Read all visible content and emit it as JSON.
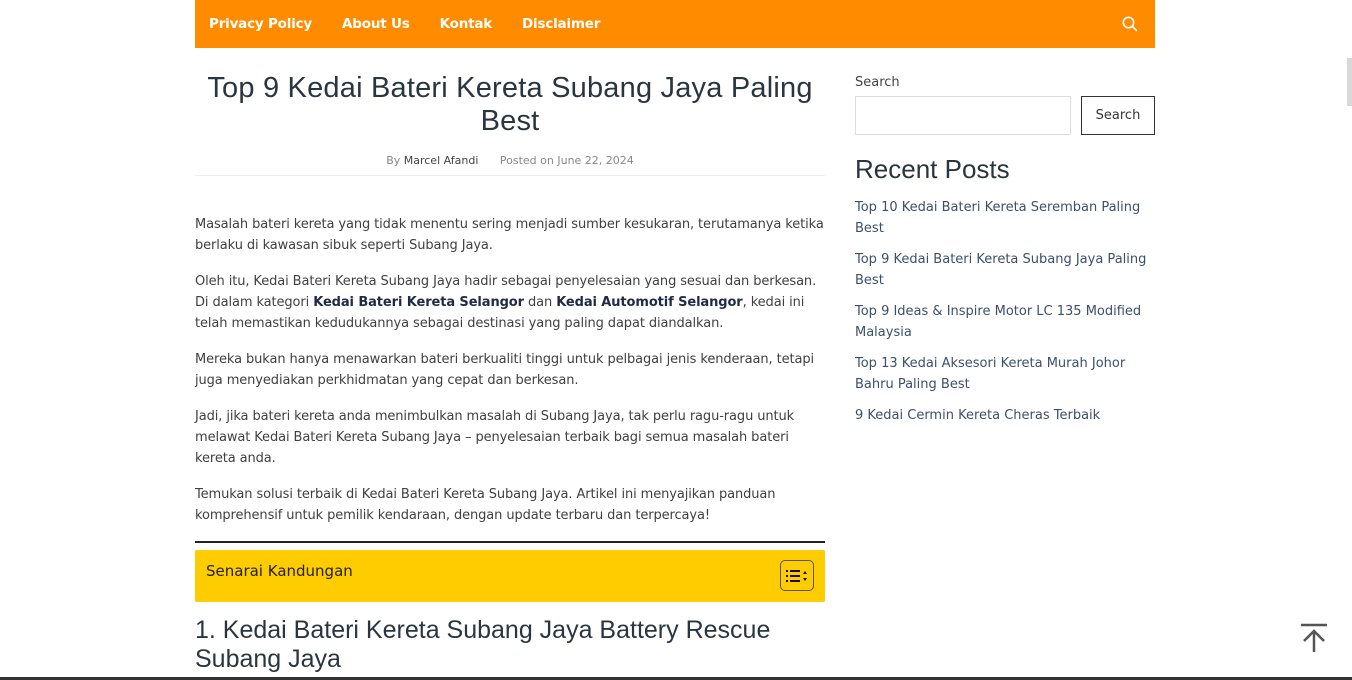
{
  "nav": {
    "items": [
      "Privacy Policy",
      "About Us",
      "Kontak",
      "Disclaimer"
    ],
    "search_icon": "search-icon",
    "bg_color": "#ff8c00"
  },
  "article": {
    "title": "Top 9 Kedai Bateri Kereta Subang Jaya Paling Best",
    "by_prefix": "By",
    "author": "Marcel Afandi",
    "posted": "Posted on June 22, 2024",
    "p1": "Masalah bateri kereta yang tidak menentu sering menjadi sumber kesukaran, terutamanya ketika berlaku di kawasan sibuk seperti Subang Jaya.",
    "p2_a": "Oleh itu, Kedai Bateri Kereta Subang Jaya hadir sebagai penyelesaian yang sesuai dan berkesan. Di dalam kategori ",
    "p2_link1": "Kedai Bateri Kereta Selangor",
    "p2_b": " dan ",
    "p2_link2": "Kedai Automotif Selangor",
    "p2_c": ", kedai ini telah memastikan kedudukannya sebagai destinasi yang paling dapat diandalkan.",
    "p3": "Mereka bukan hanya menawarkan bateri berkualiti tinggi untuk pelbagai jenis kenderaan, tetapi juga menyediakan perkhidmatan yang cepat dan berkesan.",
    "p4": "Jadi, jika bateri kereta anda menimbulkan masalah di Subang Jaya, tak perlu ragu-ragu untuk melawat Kedai Bateri Kereta Subang Jaya – penyelesaian terbaik bagi semua masalah bateri kereta anda.",
    "p5": "Temukan solusi terbaik di Kedai Bateri Kereta Subang Jaya. Artikel ini menyajikan panduan komprehensif untuk pemilik kendaraan, dengan update terbaru dan terpercaya!",
    "toc_title": "Senarai Kandungan",
    "toc_color": "#ffcc00",
    "section1": "1. Kedai Bateri Kereta Subang Jaya Battery Rescue Subang Jaya"
  },
  "sidebar": {
    "search_label": "Search",
    "search_placeholder": "",
    "search_button": "Search",
    "recent_title": "Recent Posts",
    "recent_posts": [
      "Top 10 Kedai Bateri Kereta Seremban Paling Best",
      "Top 9 Kedai Bateri Kereta Subang Jaya Paling Best",
      "Top 9 Ideas & Inspire Motor LC 135 Modified Malaysia",
      "Top 13 Kedai Aksesori Kereta Murah Johor Bahru Paling Best",
      "9 Kedai Cermin Kereta Cheras Terbaik"
    ]
  },
  "back_to_top_icon": "arrow-up-to-line-icon"
}
